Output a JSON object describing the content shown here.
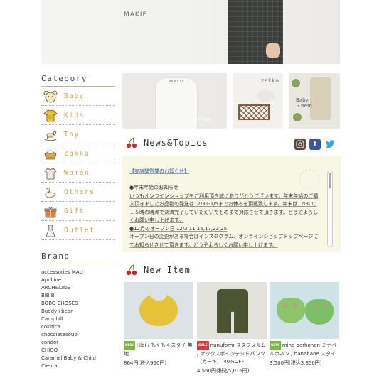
{
  "hero": {
    "brand": "MAKIE"
  },
  "sidebar": {
    "category_heading": "Category",
    "categories": [
      {
        "label": "Baby",
        "icon": "baby-bear-icon"
      },
      {
        "label": "Kids",
        "icon": "kids-shirt-icon"
      },
      {
        "label": "Toy",
        "icon": "rocking-horse-icon"
      },
      {
        "label": "Zakka",
        "icon": "basket-icon"
      },
      {
        "label": "Women",
        "icon": "women-blouse-icon"
      },
      {
        "label": "Others",
        "icon": "swan-icon"
      },
      {
        "label": "Gift",
        "icon": "gift-box-icon"
      },
      {
        "label": "Outlet",
        "icon": "outlet-dress-icon"
      }
    ],
    "brand_heading": "Brand",
    "brands": [
      "accessories MAU",
      "Apolline",
      "ARCH&LINE",
      "BIBIB",
      "BOBO CHOSES",
      "Buddy+bear",
      "Camphill",
      "cokitica",
      "chocolatesoup",
      "condor",
      "CHIGO",
      "Caramel Baby & Child",
      "Cienta"
    ]
  },
  "thumbs": {
    "woman": "woman",
    "zakka": "zakka",
    "baby": "Baby\n・Item"
  },
  "news": {
    "title": "News&Topics",
    "lines": [
      "【実店舗営業のお知らせ】",
      "",
      "●年末年始のお知らせ",
      "いつもオンラインショップをご利用頂き誠にありがとうございます。年末年始のご購",
      "入頂きましたお品物の発送は12/31-1/5までお休みを頂戴致します。年末は12/30の",
      "１５時の時点で決済完了していただいたものまで対応させて頂きます。どうぞよろし",
      "くお願い申し上げます。",
      "●12月のオープン日 12/3,11,16,17,23,25",
      "オープン日の変更がある場合はインスタグラム、オンラインショップトップページに",
      "てお知らせさせて頂きます。どうぞよろしくお願い申し上げます。"
    ]
  },
  "social": {
    "instagram": "instagram-icon",
    "facebook": "f",
    "twitter": "🐦"
  },
  "new_item": {
    "title": "New Item",
    "products": [
      {
        "badge": "NEW",
        "name": "Hibi / もくもくスタイ 無地",
        "price": "864円(税込950円)"
      },
      {
        "badge": "SALE",
        "name": "nunuform ヌヌフォルム / オックスボインテッドパンツ（カーキ） 40%OFF",
        "price": "4,560円(税込5,016円)"
      },
      {
        "badge": "NEW",
        "name": "mina perhonen ミナペルホネン / hanahane スタイ",
        "price": "3,500円(税込3,850円)"
      }
    ]
  }
}
